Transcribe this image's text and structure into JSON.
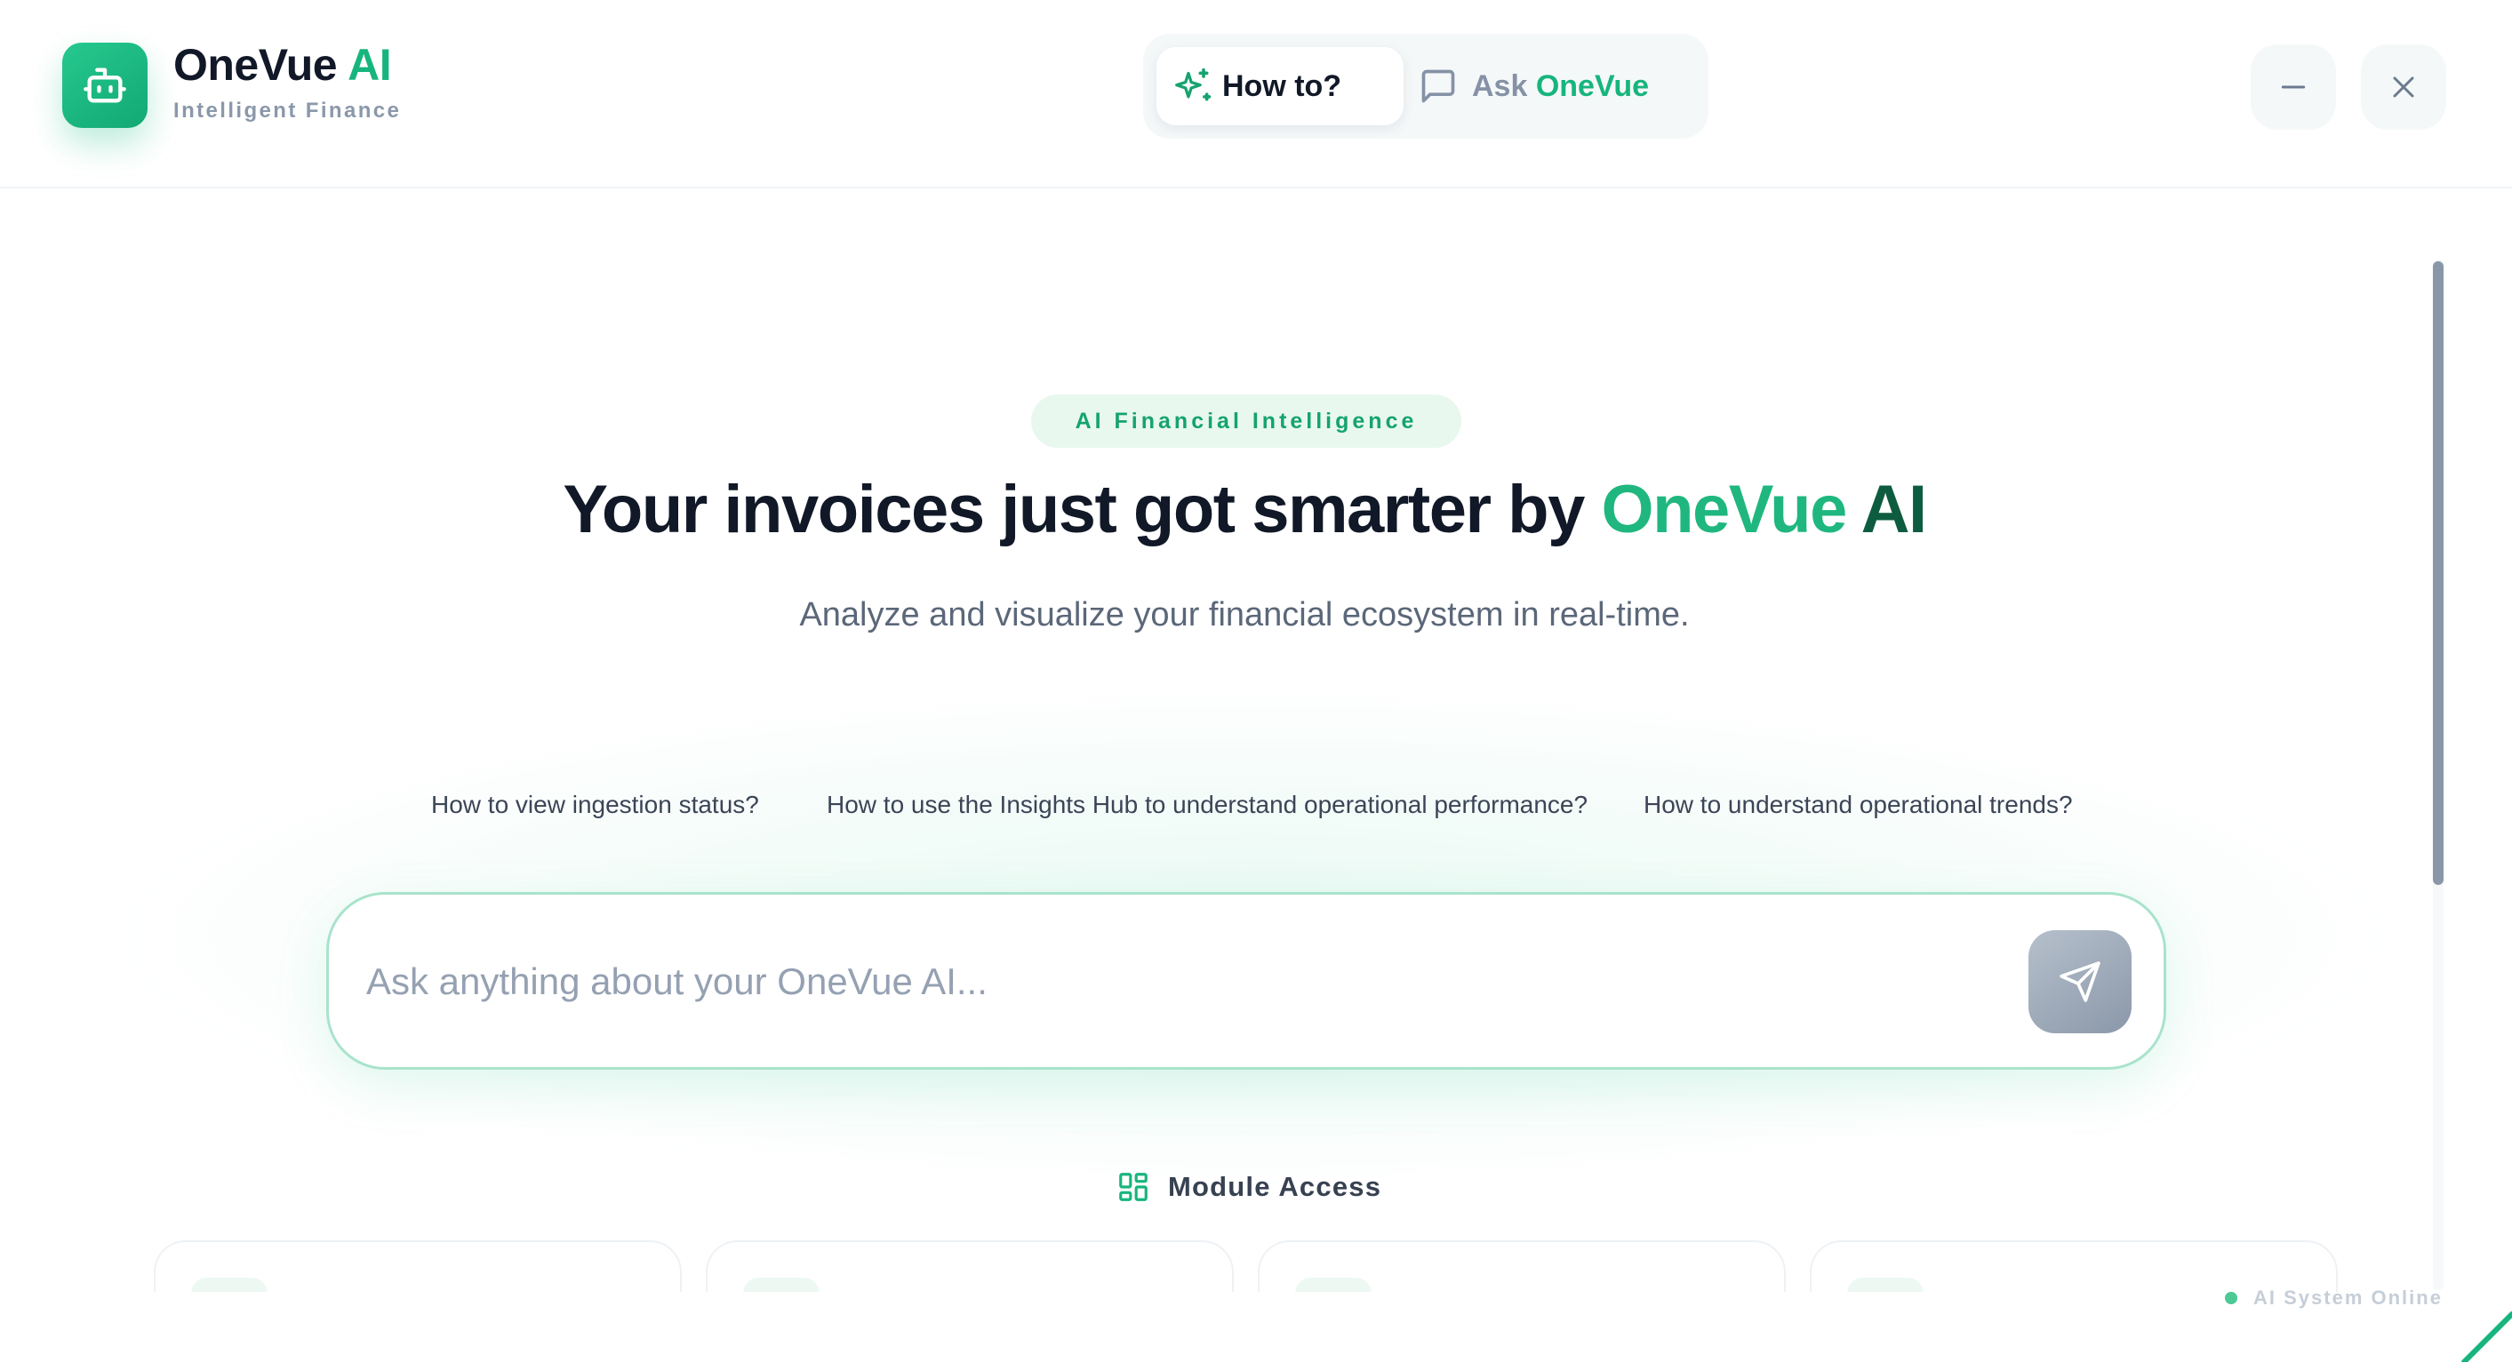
{
  "brand": {
    "name": "OneVue",
    "name_accent": "AI",
    "tagline": "Intelligent Finance"
  },
  "mode_switch": {
    "howto_label": "How to?",
    "ask_prefix": "Ask",
    "ask_accent": "OneVue",
    "active": "How to?"
  },
  "window_controls": {
    "minimize_icon": "minus-icon",
    "close_icon": "close-icon"
  },
  "hero": {
    "badge": "AI Financial Intelligence",
    "headline_prefix": "Your invoices just got smarter by",
    "headline_accent_a": "OneVue",
    "headline_accent_b": "AI",
    "subheadline": "Analyze and visualize your financial ecosystem in real-time."
  },
  "suggestions": [
    "How to view ingestion status?",
    "How to use the Insights Hub to understand operational performance?",
    "How to understand operational trends?"
  ],
  "search": {
    "placeholder": "Ask anything about your OneVue AI...",
    "value": "",
    "send_icon": "send-icon"
  },
  "modules": {
    "heading": "Module Access",
    "heading_icon": "grid-icon",
    "cards": [
      {},
      {},
      {},
      {}
    ]
  },
  "status": {
    "text": "AI System Online",
    "color": "#4cc995"
  },
  "colors": {
    "accent": "#17b57d",
    "accent_dark": "#0e5c3f",
    "text_primary": "#111827",
    "text_muted": "#8592a6"
  }
}
